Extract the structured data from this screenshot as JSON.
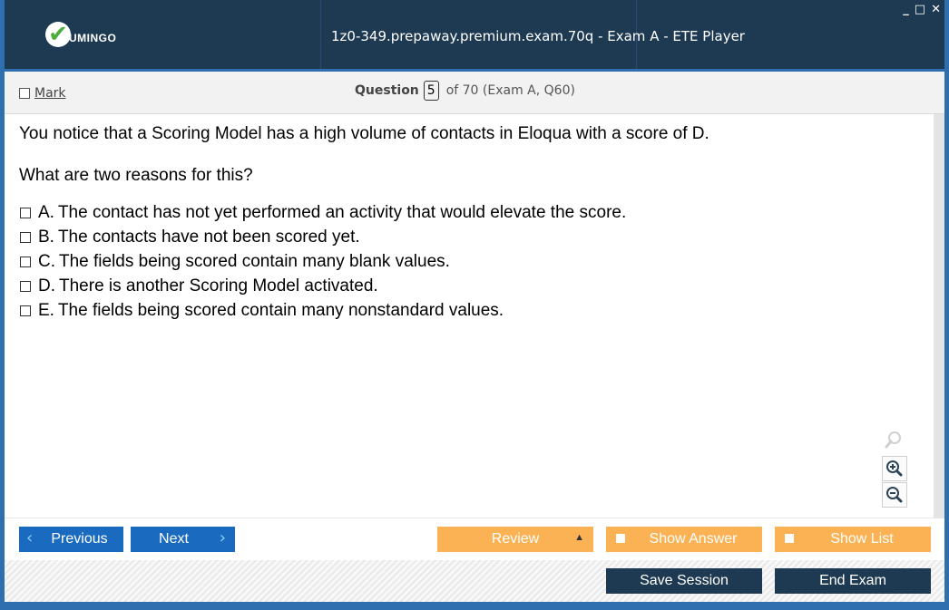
{
  "app": {
    "logo_text": "UMINGO",
    "window_title": "1z0-349.prepaway.premium.exam.70q - Exam A - ETE Player",
    "window_controls": {
      "minimize": "_",
      "maximize": "□",
      "close": "✕"
    }
  },
  "question_header": {
    "mark_label": "Mark",
    "question_label": "Question",
    "current_number": "5",
    "total_text": "of 70 (Exam A, Q60)"
  },
  "question": {
    "text": "You notice that a Scoring Model has a high volume of contacts in Eloqua with a score of D.",
    "prompt": "What are two reasons for this?",
    "options": [
      {
        "letter": "A.",
        "text": "The contact has not yet performed an activity that would elevate the score."
      },
      {
        "letter": "B.",
        "text": "The contacts have not been scored yet."
      },
      {
        "letter": "C.",
        "text": "The fields being scored contain many blank values."
      },
      {
        "letter": "D.",
        "text": "There is another Scoring Model activated."
      },
      {
        "letter": "E.",
        "text": "The fields being scored contain many nonstandard values."
      }
    ]
  },
  "zoom": {
    "icons": [
      "zoom-icon",
      "zoom-in-icon",
      "zoom-out-icon"
    ]
  },
  "navigation": {
    "previous_label": "Previous",
    "next_label": "Next",
    "review_label": "Review",
    "show_answer_label": "Show Answer",
    "show_list_label": "Show List"
  },
  "session": {
    "save_label": "Save Session",
    "end_label": "End Exam"
  },
  "colors": {
    "titlebar": "#1e3a52",
    "primary_button": "#1a6bbf",
    "orange_button": "#fbb255",
    "dark_button": "#1e3a52",
    "frame_border": "#2f6fb0"
  }
}
